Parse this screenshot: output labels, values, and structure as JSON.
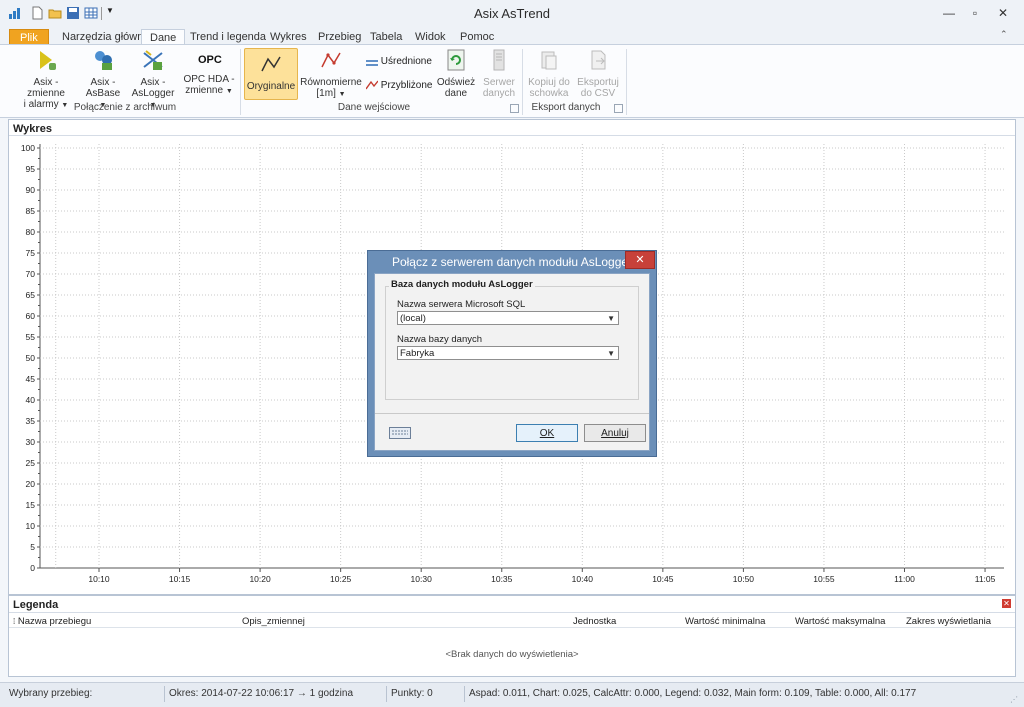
{
  "window": {
    "title": "Asix AsTrend"
  },
  "tabs": [
    "Plik",
    "Narzędzia główne",
    "Dane",
    "Trend i legenda",
    "Wykres",
    "Przebieg",
    "Tabela",
    "Widok",
    "Pomoc"
  ],
  "ribbon": {
    "group1": {
      "label": "Połączenie z archiwum",
      "buttons": [
        {
          "l1": "Asix - zmienne",
          "l2": "i alarmy",
          "l3": ""
        },
        {
          "l1": "Asix -",
          "l2": "AsBase",
          "l3": ""
        },
        {
          "l1": "Asix -",
          "l2": "AsLogger",
          "l3": ""
        },
        {
          "l1": "OPC HDA -",
          "l2": "zmienne",
          "l3": ""
        }
      ],
      "opc_icon_text": "OPC"
    },
    "group2": {
      "label": "Dane wejściowe",
      "oryginalne": "Oryginalne",
      "rownomierne_l1": "Równomierne",
      "rownomierne_l2": "[1m]",
      "usrednione": "Uśrednione",
      "przyblizone": "Przybliżone",
      "odswiez_l1": "Odśwież",
      "odswiez_l2": "dane",
      "serwer_l1": "Serwer",
      "serwer_l2": "danych"
    },
    "group3": {
      "label": "Eksport danych",
      "kopiuj_l1": "Kopiuj do",
      "kopiuj_l2": "schowka",
      "eksport_l1": "Eksportuj",
      "eksport_l2": "do CSV"
    }
  },
  "chart_panel": {
    "title": "Wykres",
    "y_ticks": [
      "100",
      "95",
      "90",
      "85",
      "80",
      "75",
      "70",
      "65",
      "60",
      "55",
      "50",
      "45",
      "40",
      "35",
      "30",
      "25",
      "20",
      "15",
      "10",
      "5",
      "0"
    ],
    "x_ticks": [
      "10:10",
      "10:15",
      "10:20",
      "10:25",
      "10:30",
      "10:35",
      "10:40",
      "10:45",
      "10:50",
      "10:55",
      "11:00",
      "11:05"
    ]
  },
  "legend_panel": {
    "title": "Legenda",
    "columns": [
      "Nazwa przebiegu",
      "Opis_zmiennej",
      "Jednostka",
      "Wartość minimalna",
      "Wartość maksymalna",
      "Zakres wyświetlania"
    ],
    "empty_text": "<Brak danych do wyświetlenia>"
  },
  "statusbar": {
    "selected": "Wybrany przebieg:",
    "period": "Okres: 2014-07-22  10:06:17 → 1 godzina",
    "points": "Punkty: 0",
    "timings": "Aspad: 0.011, Chart: 0.025, CalcAttr: 0.000, Legend: 0.032, Main form: 0.109, Table: 0.000, All: 0.177"
  },
  "dialog": {
    "title": "Połącz z serwerem danych modułu AsLogger",
    "group_title": "Baza danych modułu AsLogger",
    "server_label": "Nazwa serwera Microsoft SQL",
    "server_value": "(local)",
    "db_label": "Nazwa bazy danych",
    "db_value": "Fabryka",
    "ok": "OK",
    "cancel": "Anuluj"
  },
  "colors": {
    "accent": "#f0a320",
    "dialog_frame": "#6b8fb8",
    "close": "#c7413a"
  }
}
